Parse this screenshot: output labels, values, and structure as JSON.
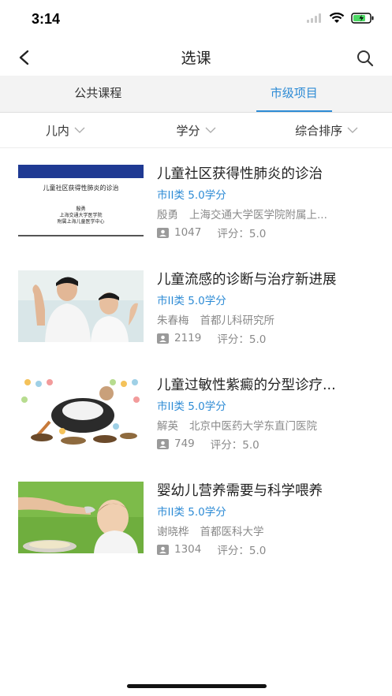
{
  "status": {
    "time": "3:14"
  },
  "nav": {
    "title": "选课"
  },
  "tabs": [
    {
      "label": "公共课程",
      "active": false
    },
    {
      "label": "市级项目",
      "active": true
    }
  ],
  "filters": [
    {
      "label": "儿内"
    },
    {
      "label": "学分"
    },
    {
      "label": "综合排序"
    }
  ],
  "courses": [
    {
      "title": "儿童社区获得性肺炎的诊治",
      "meta": "市II类 5.0学分",
      "teacher": "殷勇",
      "institution": "上海交通大学医学院附属上...",
      "count": "1047",
      "score": "评分：5.0",
      "thumb": {
        "title": "儿童社区获得性肺炎的诊治",
        "line1": "殷勇",
        "line2": "上海交通大学医学院",
        "line3": "附属上海儿童医学中心"
      }
    },
    {
      "title": "儿童流感的诊断与治疗新进展",
      "meta": "市II类 5.0学分",
      "teacher": "朱春梅",
      "institution": "首都儿科研究所",
      "count": "2119",
      "score": "评分：5.0"
    },
    {
      "title": "儿童过敏性紫癜的分型诊疗...",
      "meta": "市II类 5.0学分",
      "teacher": "解英",
      "institution": "北京中医药大学东直门医院",
      "count": "749",
      "score": "评分：5.0"
    },
    {
      "title": "婴幼儿营养需要与科学喂养",
      "meta": "市II类 5.0学分",
      "teacher": "谢晓桦",
      "institution": "首都医科大学",
      "count": "1304",
      "score": "评分：5.0"
    }
  ],
  "colors": {
    "accent": "#2d8bd5",
    "tabs_bg": "#f3f3f3",
    "muted": "#8a8a8a"
  }
}
